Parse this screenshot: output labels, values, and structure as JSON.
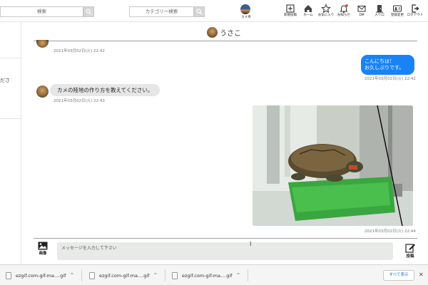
{
  "header": {
    "search_placeholder": "検索",
    "category_search_placeholder": "カテゴリー検索",
    "logo_label": "カメ男",
    "nav": [
      {
        "label": "新規投稿",
        "icon": "plus-square-icon"
      },
      {
        "label": "ホーム",
        "icon": "home-icon"
      },
      {
        "label": "お気に入り",
        "icon": "star-icon"
      },
      {
        "label": "お知らせ",
        "icon": "bell-icon"
      },
      {
        "label": "DM",
        "icon": "mail-icon"
      },
      {
        "label": "入り口",
        "icon": "door-icon"
      },
      {
        "label": "登録変更",
        "icon": "id-card-icon"
      },
      {
        "label": "ログアウト",
        "icon": "logout-icon"
      }
    ]
  },
  "sidebar": {
    "partial_text": "ださ"
  },
  "chat": {
    "partner_name": "うさこ",
    "messages": [
      {
        "from": "them",
        "text": "",
        "timestamp": "2021年03月02日(火) 22:42"
      },
      {
        "from": "me",
        "line1": "こんにちは！",
        "line2": "お久しぶりです。",
        "timestamp": "2021年03月02日(火) 22:42"
      },
      {
        "from": "them",
        "text": "カメの陸地の作り方を教えてください。",
        "timestamp": "2021年03月02日(火) 22:43"
      },
      {
        "from": "me",
        "type": "image",
        "timestamp": "2021年03月02日(火) 22:44"
      }
    ]
  },
  "composer": {
    "image_label": "画像",
    "placeholder": "メッセージを入力して下さい",
    "post_label": "投稿"
  },
  "downloads": {
    "items": [
      {
        "filename": "ezgif.com-gif-ma....gif"
      },
      {
        "filename": "ezgif.com-gif-ma....gif"
      },
      {
        "filename": "ezgif.com-gif-ma....gif"
      }
    ],
    "show_all_label": "すべて表示"
  },
  "colors": {
    "my_bubble": "#1a82f7",
    "their_bubble": "#e6e6e6",
    "input_bg": "#e8eae8"
  }
}
